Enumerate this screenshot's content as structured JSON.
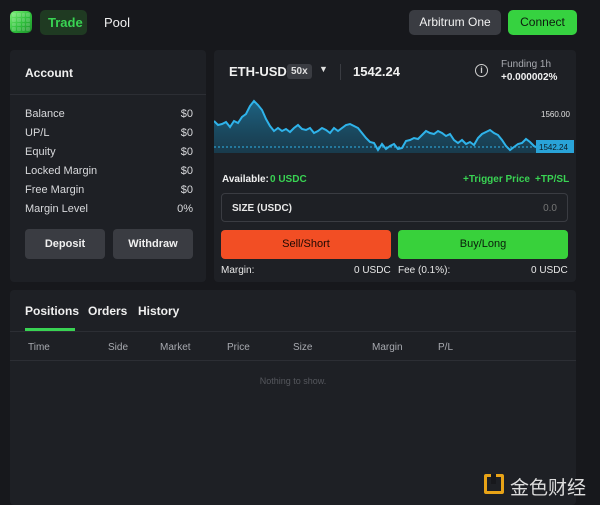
{
  "header": {
    "nav": [
      {
        "label": "Trade"
      },
      {
        "label": "Pool"
      }
    ],
    "network_label": "Arbitrum One",
    "connect_label": "Connect"
  },
  "account": {
    "title": "Account",
    "rows": [
      {
        "label": "Balance",
        "value": "$0"
      },
      {
        "label": "UP/L",
        "value": "$0"
      },
      {
        "label": "Equity",
        "value": "$0"
      },
      {
        "label": "Locked Margin",
        "value": "$0"
      },
      {
        "label": "Free Margin",
        "value": "$0"
      },
      {
        "label": "Margin Level",
        "value": "0%"
      }
    ],
    "deposit_label": "Deposit",
    "withdraw_label": "Withdraw"
  },
  "market": {
    "pair": "ETH-USD",
    "leverage": "50x",
    "price": "1542.24",
    "funding_label": "Funding 1h",
    "funding_value": "+0.000002%"
  },
  "chart": {
    "price_label_top": "1560.00",
    "current_price_label": "1542.24",
    "colors": {
      "line": "#2aa8e0",
      "fill": "#14506b",
      "dash": "#2aa8e0",
      "badge": "#29a3d8"
    }
  },
  "order": {
    "available_label": "Available:",
    "available_value": "0 USDC",
    "trigger_price_label": "+Trigger Price",
    "tpsl_label": "+TP/SL",
    "size_label": "SIZE (USDC)",
    "size_value": "0.0",
    "sell_label": "Sell/Short",
    "buy_label": "Buy/Long",
    "margin_label": "Margin:",
    "margin_value": "0 USDC",
    "fee_label": "Fee (0.1%):",
    "fee_value": "0 USDC"
  },
  "positions": {
    "tabs": [
      {
        "label": "Positions"
      },
      {
        "label": "Orders"
      },
      {
        "label": "History"
      }
    ],
    "columns": [
      "Time",
      "Side",
      "Market",
      "Price",
      "Size",
      "Margin",
      "P/L"
    ],
    "empty_text": "Nothing to show."
  },
  "watermark": {
    "text": "金色财经"
  },
  "colors": {
    "accent": "#39d353",
    "sell": "#f24e24",
    "buy": "#38d13b",
    "background": "#17181c",
    "panel": "#1e2025"
  }
}
